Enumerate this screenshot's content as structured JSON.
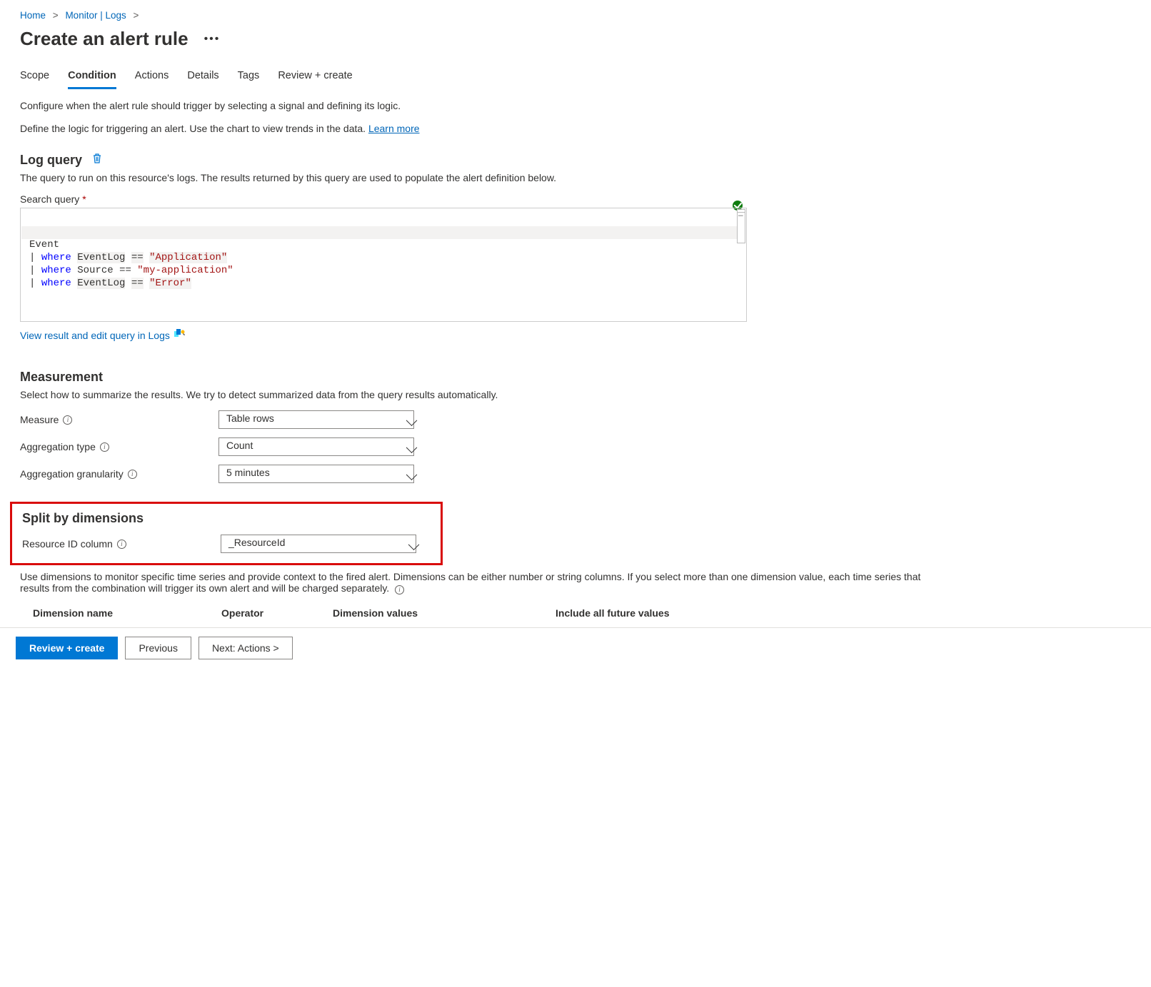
{
  "breadcrumb": {
    "home": "Home",
    "monitor": "Monitor | Logs"
  },
  "title": "Create an alert rule",
  "tabs": [
    {
      "id": "scope",
      "label": "Scope"
    },
    {
      "id": "condition",
      "label": "Condition"
    },
    {
      "id": "actions",
      "label": "Actions"
    },
    {
      "id": "details",
      "label": "Details"
    },
    {
      "id": "tags",
      "label": "Tags"
    },
    {
      "id": "review",
      "label": "Review + create"
    }
  ],
  "helptext": {
    "line1": "Configure when the alert rule should trigger by selecting a signal and defining its logic.",
    "line2_pre": "Define the logic for triggering an alert. Use the chart to view trends in the data. ",
    "learn_more": "Learn more"
  },
  "log_query": {
    "heading": "Log query",
    "desc": "The query to run on this resource's logs. The results returned by this query are used to populate the alert definition below.",
    "search_label": "Search query",
    "query": {
      "l1": "Event",
      "l2_field": "EventLog",
      "l2_op": "==",
      "l2_val": "\"Application\"",
      "l3_field": "Source",
      "l3_op": "==",
      "l3_val": "\"my-application\"",
      "l4_field": "EventLog",
      "l4_op": "==",
      "l4_val": "\"Error\""
    },
    "view_link": "View result and edit query in Logs"
  },
  "measurement": {
    "heading": "Measurement",
    "desc": "Select how to summarize the results. We try to detect summarized data from the query results automatically.",
    "measure_label": "Measure",
    "measure_value": "Table rows",
    "aggtype_label": "Aggregation type",
    "aggtype_value": "Count",
    "agggran_label": "Aggregation granularity",
    "agggran_value": "5 minutes"
  },
  "split": {
    "heading": "Split by dimensions",
    "rid_label": "Resource ID column",
    "rid_value": "_ResourceId",
    "desc1": "Use dimensions to monitor specific time series and provide context to the fired alert. Dimensions can be either number or string columns. If you select more than one dimension value, each time series that results from the combination will trigger its own alert and will be charged separately.",
    "col1": "Dimension name",
    "col2": "Operator",
    "col3": "Dimension values",
    "col4": "Include all future values"
  },
  "buttons": {
    "review": "Review + create",
    "prev": "Previous",
    "next": "Next: Actions >"
  }
}
